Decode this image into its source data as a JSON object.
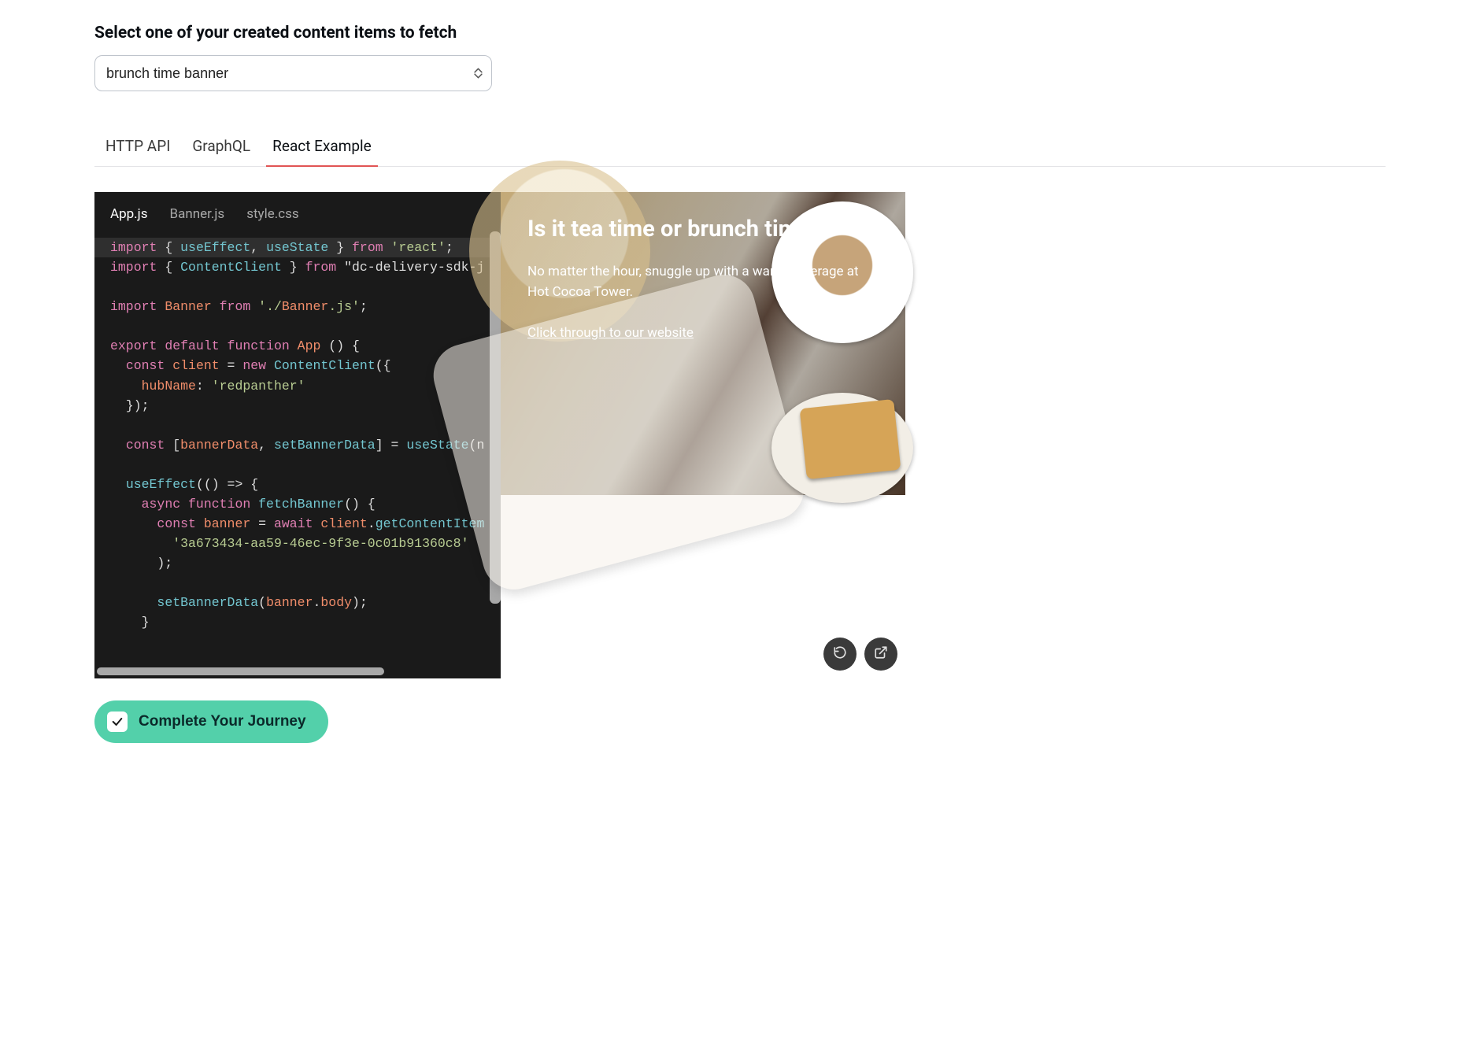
{
  "header": {
    "select_label": "Select one of your created content items to fetch",
    "selected_item": "brunch time banner"
  },
  "tabs": [
    {
      "label": "HTTP API",
      "active": false
    },
    {
      "label": "GraphQL",
      "active": false
    },
    {
      "label": "React Example",
      "active": true
    }
  ],
  "editor": {
    "files": [
      {
        "name": "App.js",
        "active": true
      },
      {
        "name": "Banner.js",
        "active": false
      },
      {
        "name": "style.css",
        "active": false
      }
    ],
    "code": {
      "visible_lines": [
        "import { useEffect, useState } from 'react';",
        "import { ContentClient } from \"dc-delivery-sdk-j",
        "",
        "import Banner from './Banner.js';",
        "",
        "export default function App () {",
        "  const client = new ContentClient({",
        "    hubName: 'redpanther'",
        "  });",
        "",
        "  const [bannerData, setBannerData] = useState(n",
        "",
        "  useEffect(() => {",
        "    async function fetchBanner() {",
        "      const banner = await client.getContentItem",
        "        '3a673434-aa59-46ec-9f3e-0c01b91360c8'",
        "      );",
        "",
        "      setBannerData(banner.body);",
        "    }"
      ],
      "hubName": "redpanther",
      "contentId": "3a673434-aa59-46ec-9f3e-0c01b91360c8"
    }
  },
  "preview": {
    "banner": {
      "title": "Is it tea time or brunch time?",
      "body": "No matter the hour, snuggle up with a warm beverage at Hot Cocoa Tower.",
      "link_text": "Click through to our website"
    },
    "action_icons": {
      "refresh": "refresh-icon",
      "open": "external-link-icon"
    }
  },
  "cta": {
    "label": "Complete Your Journey",
    "checked": true
  }
}
